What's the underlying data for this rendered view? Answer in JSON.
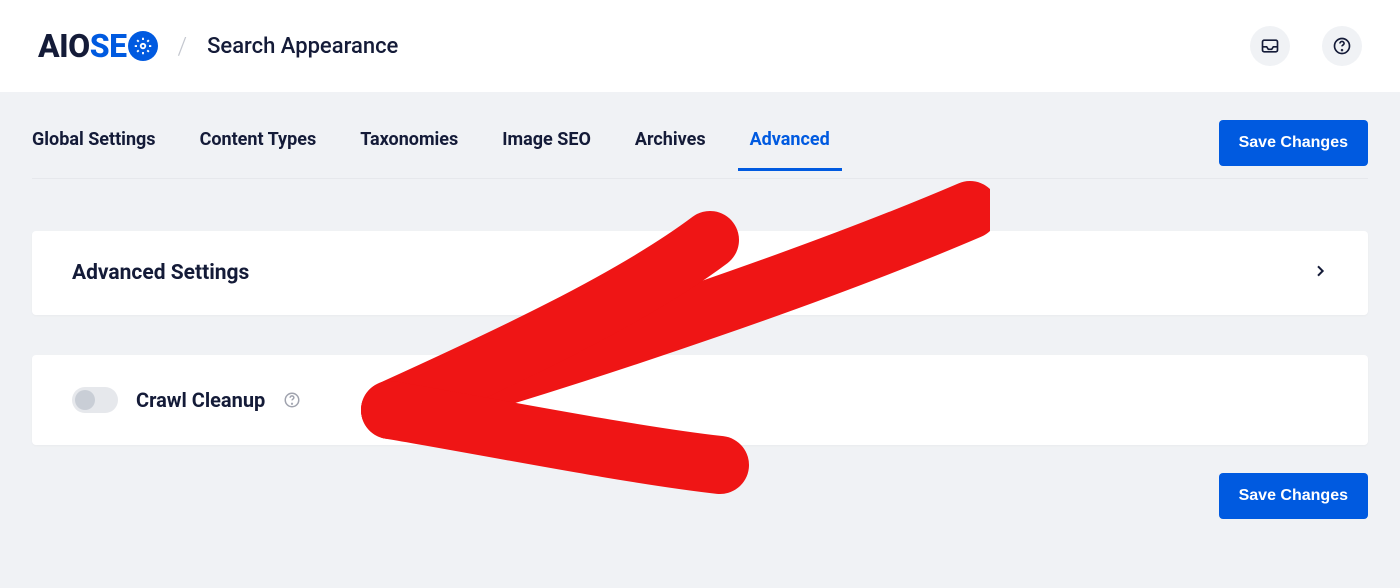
{
  "header": {
    "logo_prefix": "AIO",
    "logo_suffix": "SE",
    "page_title": "Search Appearance"
  },
  "tabs": [
    {
      "label": "Global Settings",
      "active": false
    },
    {
      "label": "Content Types",
      "active": false
    },
    {
      "label": "Taxonomies",
      "active": false
    },
    {
      "label": "Image SEO",
      "active": false
    },
    {
      "label": "Archives",
      "active": false
    },
    {
      "label": "Advanced",
      "active": true
    }
  ],
  "buttons": {
    "save": "Save Changes"
  },
  "cards": {
    "advanced_title": "Advanced Settings",
    "crawl_label": "Crawl Cleanup"
  }
}
